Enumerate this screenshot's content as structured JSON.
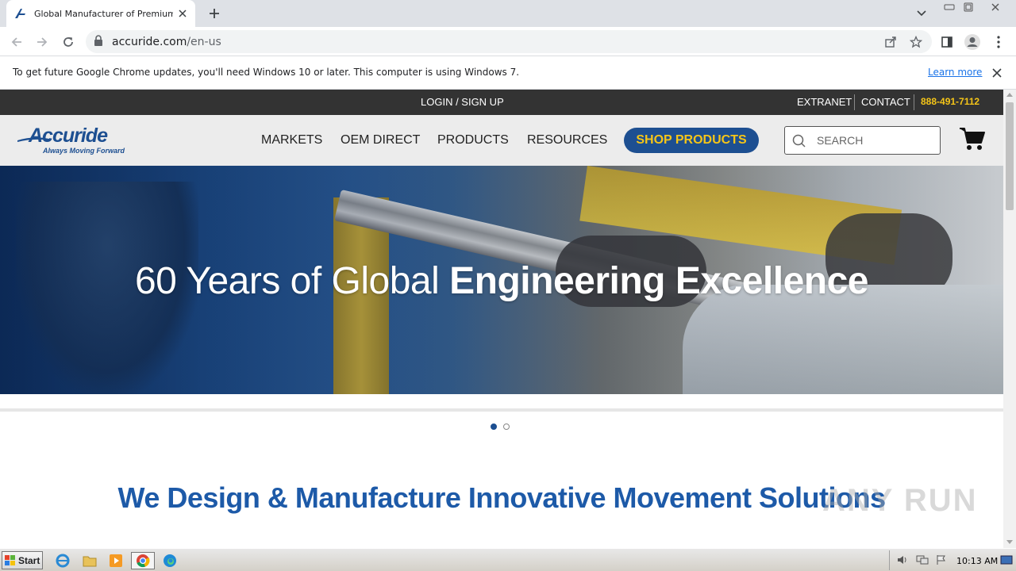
{
  "browser": {
    "tab_title": "Global Manufacturer of Premium Ball",
    "url_domain": "accuride.com",
    "url_path": "/en-us",
    "infobar_message": "To get future Google Chrome updates, you'll need Windows 10 or later. This computer is using Windows 7.",
    "infobar_link": "Learn more"
  },
  "site": {
    "topbar": {
      "login": "LOGIN / SIGN UP",
      "extranet": "EXTRANET",
      "contact": "CONTACT",
      "phone": "888-491-7112"
    },
    "logo": {
      "word": "Accuride",
      "tagline": "Always Moving Forward"
    },
    "nav": {
      "items": [
        "MARKETS",
        "OEM DIRECT",
        "PRODUCTS",
        "RESOURCES"
      ],
      "shop_label": "SHOP PRODUCTS",
      "search_placeholder": "SEARCH"
    },
    "hero": {
      "title_light": "60 Years of Global ",
      "title_bold": "Engineering Excellence",
      "slides": 2,
      "active_slide": 1
    },
    "tagline": "We Design & Manufacture Innovative Movement Solutions"
  },
  "watermark": "ANY RUN",
  "taskbar": {
    "start_label": "Start",
    "clock": "10:13 AM"
  },
  "colors": {
    "brand_blue": "#1d4f91",
    "accent_yellow": "#f5c518",
    "topbar_bg": "#333333",
    "tagline_blue": "#1d5aa8"
  }
}
